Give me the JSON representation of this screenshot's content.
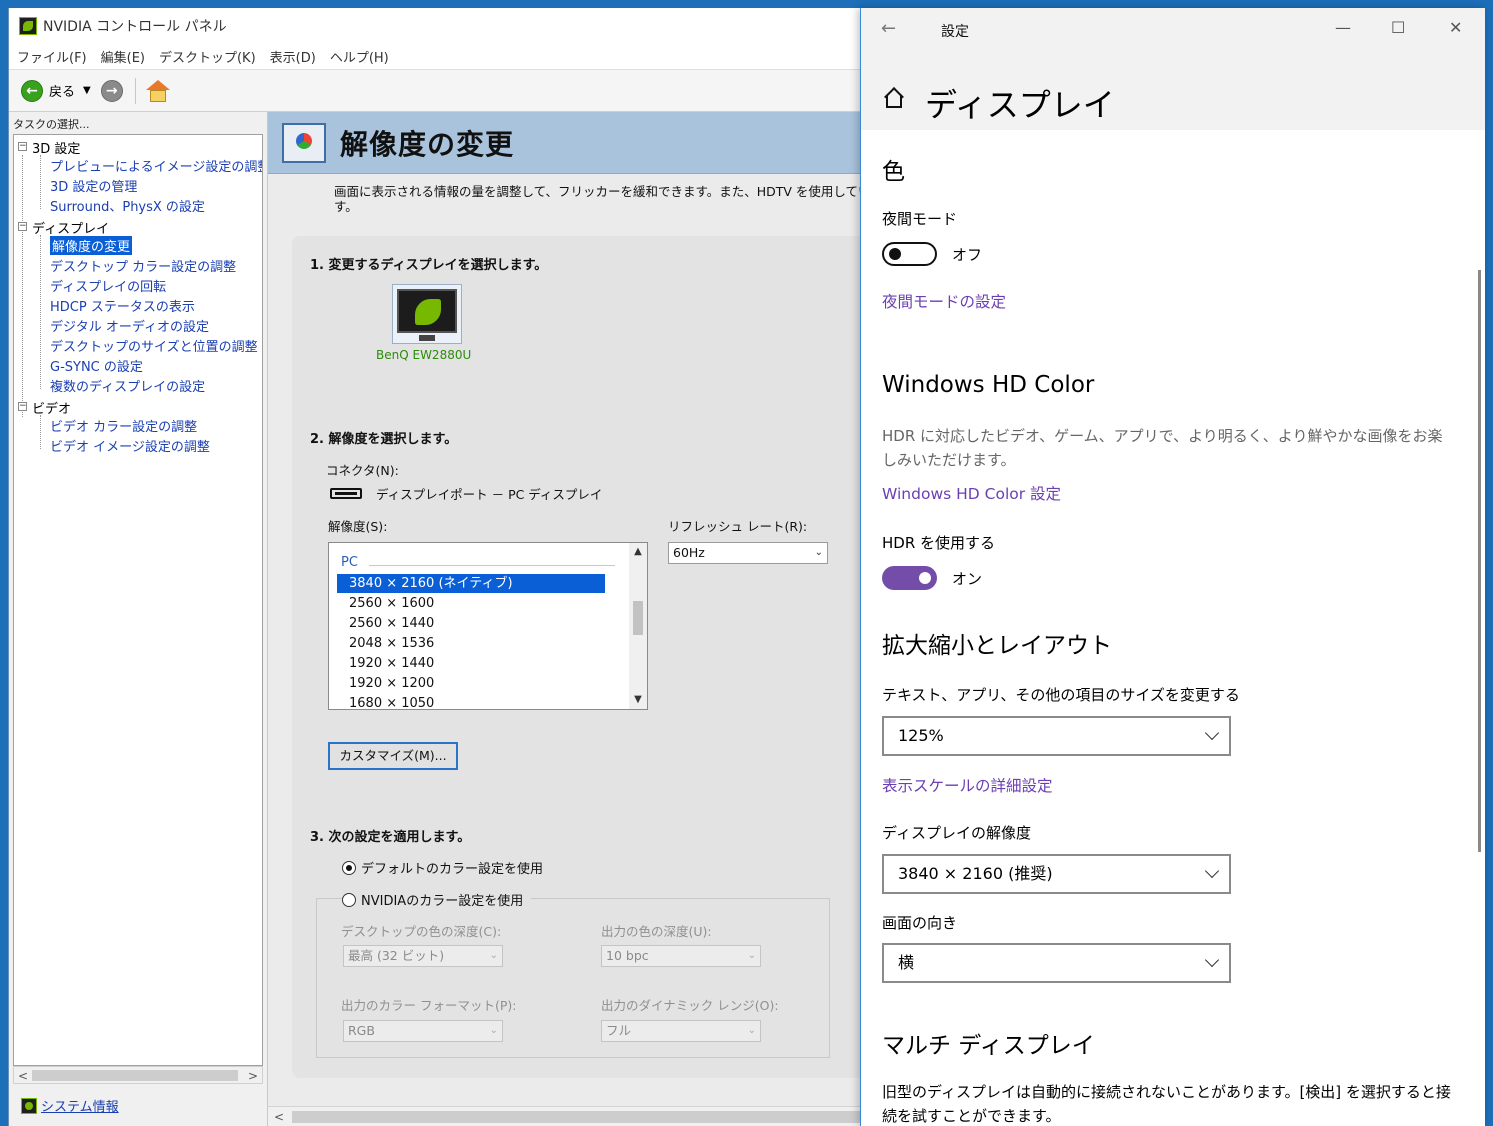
{
  "nvidia": {
    "title": "NVIDIA コントロール パネル",
    "menu": [
      "ファイル(F)",
      "編集(E)",
      "デスクトップ(K)",
      "表示(D)",
      "ヘルプ(H)"
    ],
    "toolbar": {
      "back_label": "戻る"
    },
    "task_label": "タスクの選択...",
    "tree": {
      "g3d": "3D 設定",
      "g3d_items": [
        "プレビューによるイメージ設定の調整",
        "3D 設定の管理",
        "Surround、PhysX の設定"
      ],
      "gdisp": "ディスプレイ",
      "gdisp_items": [
        "解像度の変更",
        "デスクトップ カラー設定の調整",
        "ディスプレイの回転",
        "HDCP ステータスの表示",
        "デジタル オーディオの設定",
        "デスクトップのサイズと位置の調整",
        "G-SYNC の設定",
        "複数のディスプレイの設定"
      ],
      "gvid": "ビデオ",
      "gvid_items": [
        "ビデオ カラー設定の調整",
        "ビデオ イメージ設定の調整"
      ]
    },
    "system_info": "システム情報",
    "page_title": "解像度の変更",
    "description_line1": "画面に表示される情報の量を調整して、フリッカーを緩和できます。また、HDTV を使用してい",
    "description_line2": "す。",
    "step1": "1. 変更するディスプレイを選択します。",
    "monitor_name": "BenQ EW2880U",
    "step2": "2. 解像度を選択します。",
    "connector_label": "コネクタ(N):",
    "connector_value": "ディスプレイポート － PC ディスプレイ",
    "resolution_label": "解像度(S):",
    "refresh_label": "リフレッシュ レート(R):",
    "refresh_value": "60Hz",
    "res_group": "PC",
    "resolutions": [
      "3840 × 2160 (ネイティブ)",
      "2560 × 1600",
      "2560 × 1440",
      "2048 × 1536",
      "1920 × 1440",
      "1920 × 1200",
      "1680 × 1050"
    ],
    "customize_button": "カスタマイズ(M)...",
    "step3": "3. 次の設定を適用します。",
    "radio_default": "デフォルトのカラー設定を使用",
    "radio_nvidia": "NVIDIAのカラー設定を使用",
    "desktop_depth_label": "デスクトップの色の深度(C):",
    "desktop_depth_value": "最高 (32 ビット)",
    "output_depth_label": "出力の色の深度(U):",
    "output_depth_value": "10 bpc",
    "output_format_label": "出力のカラー フォーマット(P):",
    "output_format_value": "RGB",
    "dynamic_range_label": "出力のダイナミック レンジ(O):",
    "dynamic_range_value": "フル"
  },
  "settings": {
    "window_title": "設定",
    "page_title": "ディスプレイ",
    "color_heading": "色",
    "night_mode_label": "夜間モード",
    "night_mode_state": "オフ",
    "night_mode_link": "夜間モードの設定",
    "hd_color_heading": "Windows HD Color",
    "hd_color_desc": "HDR に対応したビデオ、ゲーム、アプリで、より明るく、より鮮やかな画像をお楽しみいただけます。",
    "hd_color_link": "Windows HD Color 設定",
    "hdr_label": "HDR を使用する",
    "hdr_state": "オン",
    "scale_heading": "拡大縮小とレイアウト",
    "scale_label": "テキスト、アプリ、その他の項目のサイズを変更する",
    "scale_value": "125%",
    "scale_link": "表示スケールの詳細設定",
    "resolution_label": "ディスプレイの解像度",
    "resolution_value": "3840 × 2160 (推奨)",
    "orientation_label": "画面の向き",
    "orientation_value": "横",
    "multi_heading": "マルチ ディスプレイ",
    "multi_desc": "旧型のディスプレイは自動的に接続されないことがあります。[検出] を選択すると接続を試すことができます。"
  }
}
